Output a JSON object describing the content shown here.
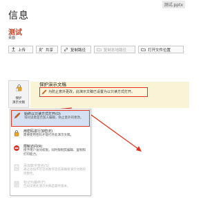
{
  "window": {
    "file_label": "测试.pptx"
  },
  "page": {
    "title": "信息"
  },
  "document": {
    "name": "测试",
    "location": "桌面"
  },
  "toolbar": {
    "upload": "上传",
    "share": "共享",
    "copy_path": "复制路径",
    "copy_local_path": "复制本地路径",
    "open_location": "打开文件位置"
  },
  "protect": {
    "button_label": "保护\n演示文稿",
    "heading": "保护演示文稿",
    "warning": "为防止意外更改，此演示文稿已设置为以只读方式打开。"
  },
  "menu": {
    "items": [
      {
        "title": "始终以只读方式打开(O)",
        "desc": "询问读者是否加入编辑，防止意外的更改。",
        "state": "selected"
      },
      {
        "title": "用密码进行加密(E)",
        "desc": "需要使用密码才能打开此演示文稿。",
        "state": "normal"
      },
      {
        "title": "限制访问(R)",
        "desc": "授予用户访问权限，同时限制其编辑、复制和打印能力。",
        "state": "normal"
      },
      {
        "title": "添加数字签名(S)",
        "desc": "通过添加不可见的数字签名来确保演示文稿的完整性。",
        "state": "disabled"
      },
      {
        "title": "标记为最终(F)",
        "desc": "告知读者此演示文稿是最终版本。",
        "state": "disabled"
      }
    ]
  },
  "colors": {
    "accent_red": "#e0311f",
    "doc_title": "#c43e1c",
    "warning_bg": "#fbf3d5",
    "selected_bg": "#d5e1f2"
  }
}
